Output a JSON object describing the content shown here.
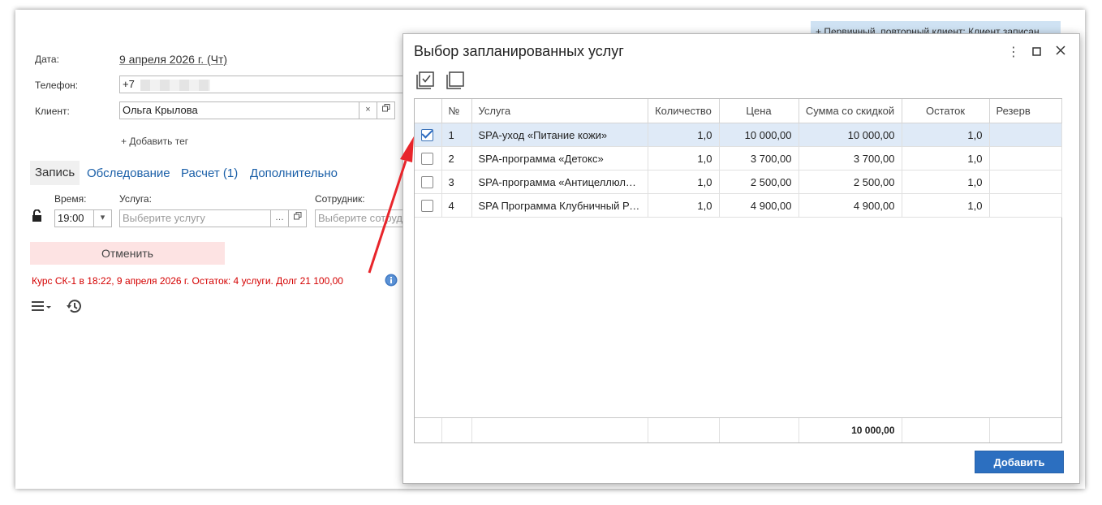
{
  "form": {
    "date_label": "Дата:",
    "date_value": "9 апреля 2026 г. (Чт)",
    "phone_label": "Телефон:",
    "phone_value": "+7",
    "client_label": "Клиент:",
    "client_value": "Ольга Крылова",
    "client_clear": "×",
    "add_tag": "+ Добавить тег",
    "banner": "+ Первичный, повторный клиент: Клиент записан",
    "tabs": [
      "Запись",
      "Обследование",
      "Расчет (1)",
      "Дополнительно"
    ],
    "time_label": "Время:",
    "time_value": "19:00",
    "service_label": "Услуга:",
    "service_placeholder": "Выберите услугу",
    "employee_label": "Сотрудник:",
    "employee_placeholder": "Выберите сотрудника",
    "cancel_label": "Отменить",
    "course_info": "Курс СК-1 в 18:22, 9 апреля 2026 г. Остаток: 4 услуги. Долг 21 100,00",
    "more": "…"
  },
  "dialog": {
    "title": "Выбор запланированных услуг",
    "columns": [
      "№",
      "Услуга",
      "Количество",
      "Цена",
      "Сумма со скидкой",
      "Остаток",
      "Резерв"
    ],
    "rows": [
      {
        "checked": true,
        "n": "1",
        "service": "SPA-уход «Питание кожи»",
        "qty": "1,0",
        "price": "10 000,00",
        "sum": "10 000,00",
        "rest": "1,0",
        "reserve": ""
      },
      {
        "checked": false,
        "n": "2",
        "service": "SPA-программа «Детокс»",
        "qty": "1,0",
        "price": "3 700,00",
        "sum": "3 700,00",
        "rest": "1,0",
        "reserve": ""
      },
      {
        "checked": false,
        "n": "3",
        "service": "SPA-программа «Антицеллюлитная»",
        "qty": "1,0",
        "price": "2 500,00",
        "sum": "2 500,00",
        "rest": "1,0",
        "reserve": ""
      },
      {
        "checked": false,
        "n": "4",
        "service": "SPA Программа Клубничный Рай",
        "qty": "1,0",
        "price": "4 900,00",
        "sum": "4 900,00",
        "rest": "1,0",
        "reserve": ""
      }
    ],
    "total_sum": "10 000,00",
    "add_button": "Добавить",
    "menu_icon": "⋮"
  },
  "colors": {
    "accent": "#2c6fc0",
    "link": "#1a5fa8",
    "warning_text": "#d40000",
    "cancel_bg": "#fde3e3",
    "arrow": "#e8252b"
  },
  "icons": [
    "check-all-icon",
    "uncheck-all-icon",
    "lock-open-icon",
    "info-icon",
    "hamburger-menu-icon",
    "history-icon",
    "kebab-menu-icon",
    "maximize-icon",
    "close-icon"
  ]
}
